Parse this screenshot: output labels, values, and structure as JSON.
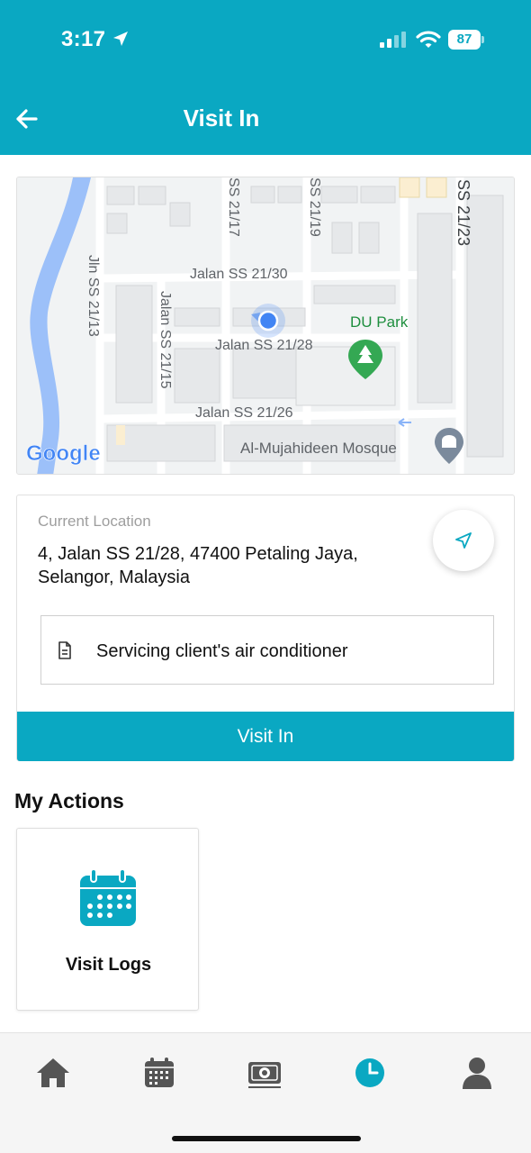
{
  "status_bar": {
    "time": "3:17",
    "battery": "87"
  },
  "header": {
    "title": "Visit In",
    "back_icon": "arrow-left-icon"
  },
  "map": {
    "labels": {
      "ss21_17": "SS 21/17",
      "ss21_19": "SS 21/19",
      "ss21_23": "SS 21/23",
      "jln_ss21_13": "Jln SS 21/13",
      "jalan_ss21_15": "Jalan SS 21/15",
      "jalan_ss21_30": "Jalan SS 21/30",
      "jalan_ss21_28": "Jalan SS 21/28",
      "jalan_ss21_26": "Jalan SS 21/26",
      "du_park": "DU Park",
      "mosque": "Al-Mujahideen Mosque",
      "google": "Google"
    }
  },
  "location_card": {
    "label": "Current Location",
    "address_line1": "4, Jalan SS 21/28, 47400 Petaling Jaya,",
    "address_line2": "Selangor, Malaysia",
    "note": "Servicing client's air conditioner",
    "button": "Visit In"
  },
  "actions": {
    "title": "My Actions",
    "items": [
      {
        "label": "Visit Logs",
        "icon": "calendar-icon"
      }
    ]
  },
  "tabbar": {
    "items": [
      {
        "icon": "home-icon",
        "active": false
      },
      {
        "icon": "calendar-icon",
        "active": false
      },
      {
        "icon": "money-icon",
        "active": false
      },
      {
        "icon": "clock-icon",
        "active": true
      },
      {
        "icon": "user-icon",
        "active": false
      }
    ]
  },
  "colors": {
    "primary": "#0aa8c2",
    "tab_inactive": "#555555",
    "map_water": "#9cc0f9",
    "park_green": "#1e8e3e"
  }
}
